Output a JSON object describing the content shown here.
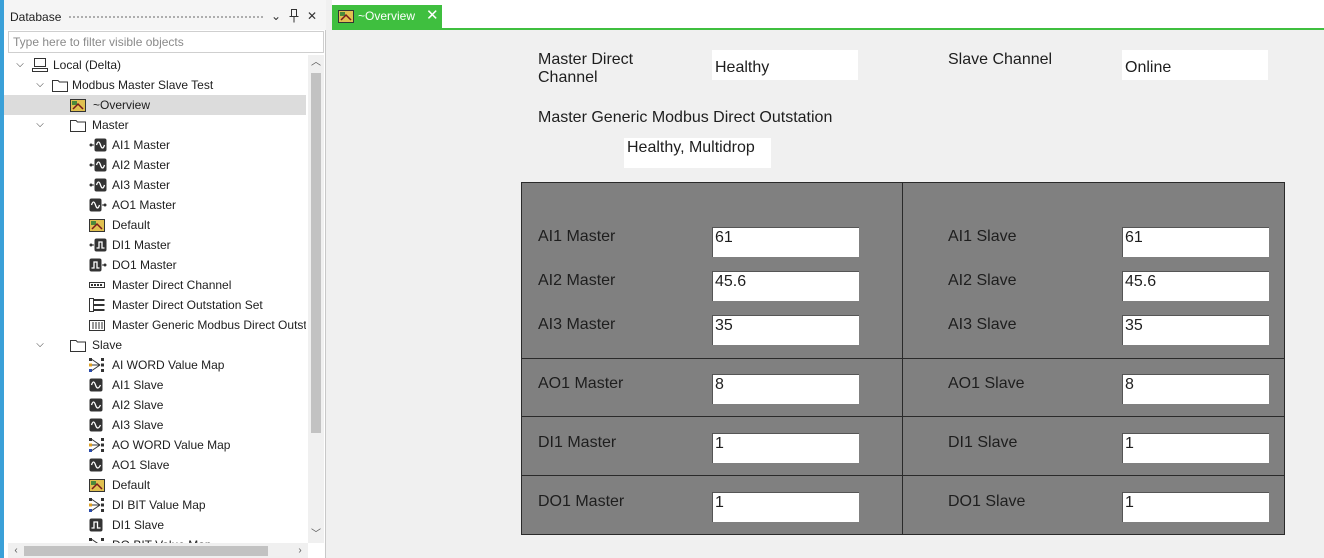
{
  "panel": {
    "title": "Database",
    "filter_placeholder": "Type here to filter visible objects"
  },
  "tree": [
    {
      "label": "Local (Delta)",
      "icon": "computer-icon",
      "expander": "expanded"
    },
    {
      "label": "Modbus Master Slave Test",
      "icon": "folder-icon",
      "expander": "expanded"
    },
    {
      "label": "~Overview",
      "icon": "mimic-icon",
      "selected": true
    },
    {
      "label": "Master",
      "icon": "folder-icon",
      "expander": "expanded"
    },
    {
      "label": "AI1 Master",
      "icon": "analog-input-point-icon"
    },
    {
      "label": "AI2 Master",
      "icon": "analog-input-point-icon"
    },
    {
      "label": "AI3 Master",
      "icon": "analog-input-point-icon"
    },
    {
      "label": "AO1 Master",
      "icon": "analog-output-point-icon"
    },
    {
      "label": "Default",
      "icon": "mimic-icon"
    },
    {
      "label": "DI1 Master",
      "icon": "digital-input-point-icon"
    },
    {
      "label": "DO1 Master",
      "icon": "digital-output-point-icon"
    },
    {
      "label": "Master Direct Channel",
      "icon": "channel-icon"
    },
    {
      "label": "Master Direct Outstation Set",
      "icon": "outstation-set-icon"
    },
    {
      "label": "Master Generic Modbus Direct Outstation",
      "icon": "outstation-icon"
    },
    {
      "label": "Slave",
      "icon": "folder-icon",
      "expander": "expanded"
    },
    {
      "label": "AI WORD Value Map",
      "icon": "value-map-icon"
    },
    {
      "label": "AI1 Slave",
      "icon": "analog-point-icon"
    },
    {
      "label": "AI2 Slave",
      "icon": "analog-point-icon"
    },
    {
      "label": "AI3 Slave",
      "icon": "analog-point-icon"
    },
    {
      "label": "AO WORD Value Map",
      "icon": "value-map-icon"
    },
    {
      "label": "AO1 Slave",
      "icon": "analog-point-icon"
    },
    {
      "label": "Default",
      "icon": "mimic-icon"
    },
    {
      "label": "DI BIT Value Map",
      "icon": "value-map-icon"
    },
    {
      "label": "DI1 Slave",
      "icon": "digital-point-icon"
    },
    {
      "label": "DO BIT Value Map",
      "icon": "value-map-icon"
    }
  ],
  "tab": {
    "label": "~Overview"
  },
  "status": {
    "master_channel_label": "Master Direct Channel",
    "master_channel_value": "Healthy",
    "slave_channel_label": "Slave Channel",
    "slave_channel_value": "Online",
    "outstation_label": "Master Generic Modbus Direct Outstation",
    "outstation_value": "Healthy, Multidrop"
  },
  "points": [
    {
      "master_label": "AI1 Master",
      "master_value": "61",
      "slave_label": "AI1 Slave",
      "slave_value": "61"
    },
    {
      "master_label": "AI2 Master",
      "master_value": "45.6",
      "slave_label": "AI2 Slave",
      "slave_value": "45.6"
    },
    {
      "master_label": "AI3 Master",
      "master_value": "35",
      "slave_label": "AI3 Slave",
      "slave_value": "35"
    },
    {
      "master_label": "AO1 Master",
      "master_value": "8",
      "slave_label": "AO1 Slave",
      "slave_value": "8"
    },
    {
      "master_label": "DI1 Master",
      "master_value": "1",
      "slave_label": "DI1 Slave",
      "slave_value": "1"
    },
    {
      "master_label": "DO1 Master",
      "master_value": "1",
      "slave_label": "DO1 Slave",
      "slave_value": "1"
    }
  ],
  "colors": {
    "tab_accent": "#3fbf3f",
    "grid_background": "#808080",
    "left_edge": "#3aa0d8"
  }
}
